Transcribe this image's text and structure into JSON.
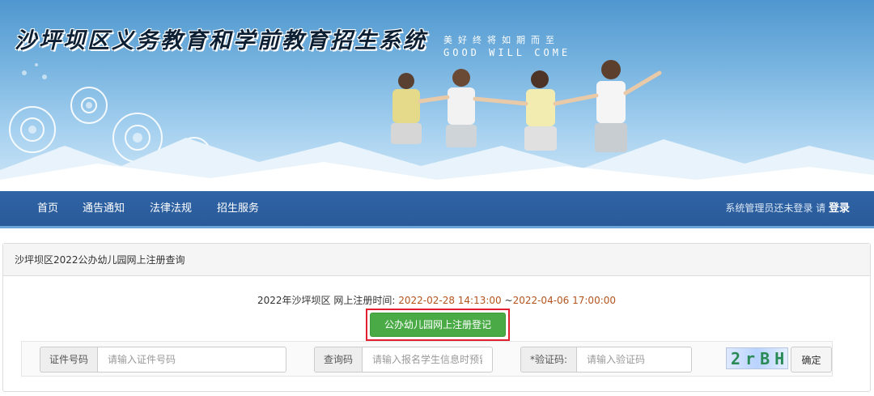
{
  "banner": {
    "title": "沙坪坝区义务教育和学前教育招生系统",
    "slogan_cn": "美好终将如期而至",
    "slogan_en": "GOOD WILL COME"
  },
  "nav": {
    "items": [
      {
        "label": "首页"
      },
      {
        "label": "通告通知"
      },
      {
        "label": "法律法规"
      },
      {
        "label": "招生服务"
      }
    ],
    "login_prompt": "系统管理员还未登录 请",
    "login_link": "登录"
  },
  "panel": {
    "heading": "沙坪坝区2022公办幼儿园网上注册查询",
    "reg_label": "2022年沙坪坝区 网上注册时间:",
    "reg_start": "2022-02-28 14:13:00",
    "reg_sep": "~",
    "reg_end": "2022-04-06 17:00:00",
    "register_button": "公办幼儿园网上注册登记"
  },
  "query": {
    "id_label": "证件号码",
    "id_placeholder": "请输入证件号码",
    "code_label": "查询码",
    "code_placeholder": "请输入报名学生信息时预留的查询码",
    "captcha_label": "*验证码:",
    "captcha_placeholder": "请输入验证码",
    "captcha_text": "2rBH",
    "confirm_button": "确定"
  },
  "colors": {
    "nav_bg": "#2f64a7",
    "register_green": "#4aab46",
    "highlight_red": "#e0202e",
    "time_orange": "#b3541e"
  }
}
